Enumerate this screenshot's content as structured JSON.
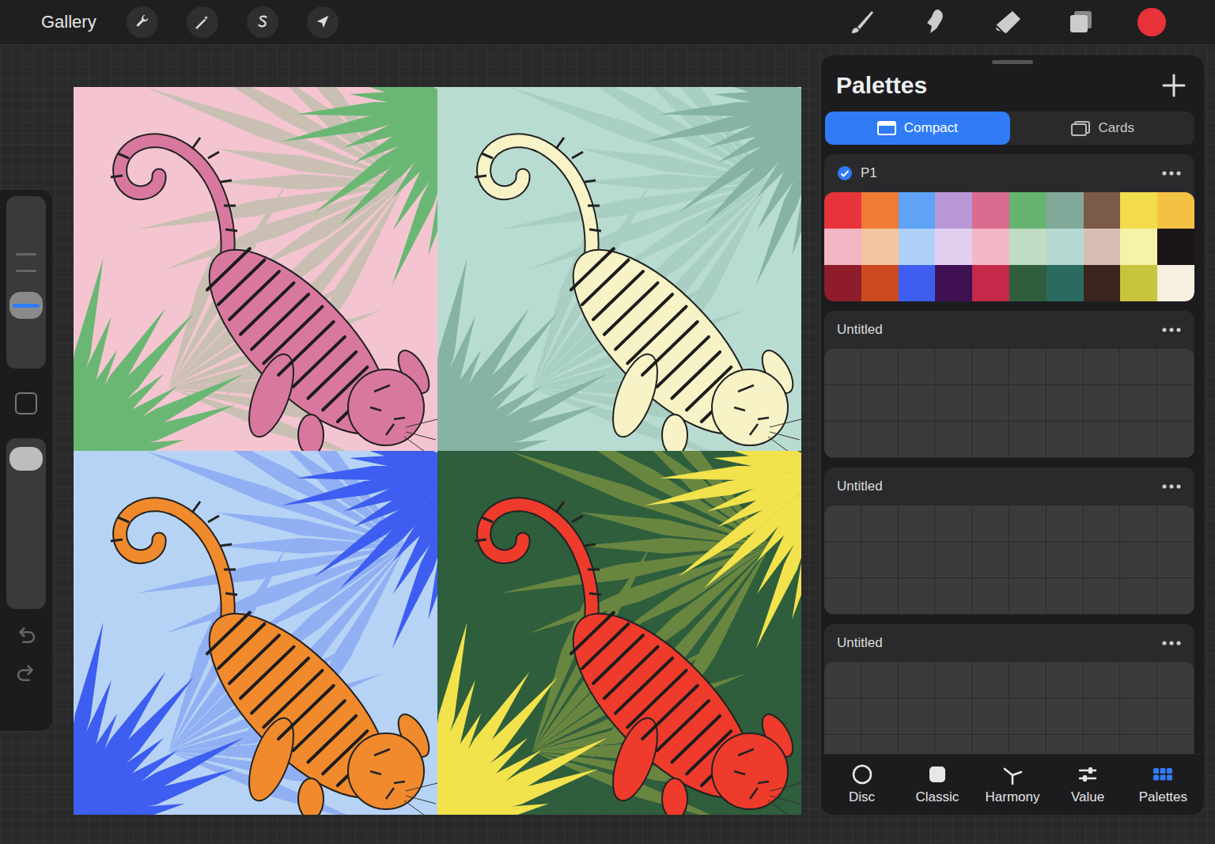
{
  "toolbar": {
    "gallery": "Gallery",
    "current_color": "#e8323a"
  },
  "sidebar": {
    "brush_size": {
      "level": 0.34
    },
    "opacity": {
      "level": 0.94
    }
  },
  "artwork": {
    "panels": [
      {
        "color": "#f4c5d0",
        "leaf_color": "#6ab774",
        "tiger_color": "#d9789e"
      },
      {
        "color": "#b9dcd2",
        "leaf_color": "#86b3a3",
        "tiger_color": "#f7f3c7"
      },
      {
        "color": "#b6d3f5",
        "leaf_color": "#3d5ef0",
        "tiger_color": "#f08a2c"
      },
      {
        "color": "#2e5e3c",
        "leaf_color": "#f2e24c",
        "tiger_color": "#ee3b2c"
      }
    ]
  },
  "palettes_panel": {
    "title": "Palettes",
    "views": [
      {
        "label": "Compact",
        "selected": true
      },
      {
        "label": "Cards",
        "selected": false
      }
    ],
    "palettes": [
      {
        "name": "P1",
        "default": true,
        "swatches": [
          "#e8333a",
          "#ef7b35",
          "#5ea3f5",
          "#b997d6",
          "#d96b8f",
          "#66b36f",
          "#82a89a",
          "#7a5a48",
          "#f2dc4c",
          "#f3c244",
          "#f2b5c3",
          "#f5c4a0",
          "#aed0f8",
          "#e2cff0",
          "#f4b7c8",
          "#bfdcc4",
          "#b5d8d0",
          "#d8bdb3",
          "#f6f2a6",
          "#1a1618",
          "#8e1c2b",
          "#cc4a22",
          "#3d5ef0",
          "#3f1152",
          "#c4294a",
          "#2e5e3c",
          "#2b6a5e",
          "#3a241c",
          "#c8c43e",
          "#f7efe0"
        ]
      },
      {
        "name": "Untitled",
        "default": false,
        "swatches": []
      },
      {
        "name": "Untitled",
        "default": false,
        "swatches": []
      },
      {
        "name": "Untitled",
        "default": false,
        "swatches": []
      }
    ]
  },
  "bottom_tabs": [
    {
      "label": "Disc",
      "selected": false
    },
    {
      "label": "Classic",
      "selected": false
    },
    {
      "label": "Harmony",
      "selected": false
    },
    {
      "label": "Value",
      "selected": false
    },
    {
      "label": "Palettes",
      "selected": true
    }
  ]
}
